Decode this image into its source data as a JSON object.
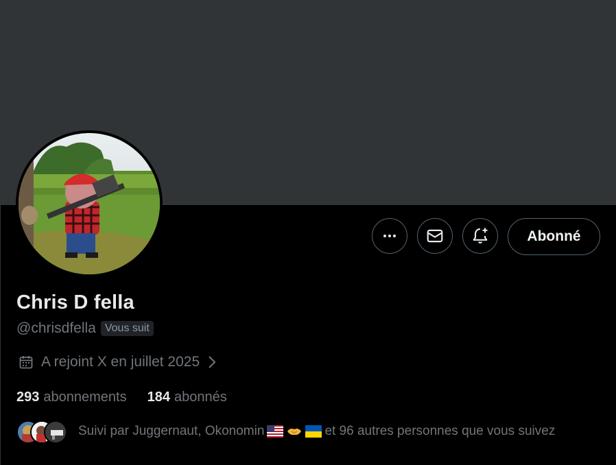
{
  "profile": {
    "display_name": "Chris D fella",
    "handle": "@chrisdfella",
    "follows_you_badge": "Vous suit",
    "joined": "A rejoint X en juillet 2025",
    "following_count": "293",
    "following_label": "abonnements",
    "followers_count": "184",
    "followers_label": "abonnés"
  },
  "actions": {
    "more_icon": "more-horizontal-icon",
    "message_icon": "envelope-icon",
    "notify_icon": "bell-plus-icon",
    "follow_label": "Abonné"
  },
  "followed_by": {
    "prefix": "Suivi par Juggernaut, Okonomin",
    "emojis": [
      "us-flag",
      "handshake",
      "ua-flag"
    ],
    "suffix": "et 96 autres personnes que vous suivez"
  },
  "colors": {
    "banner": "#313437",
    "background": "#000000",
    "text_primary": "#e7e9ea",
    "text_secondary": "#71767b",
    "border": "#536471"
  }
}
